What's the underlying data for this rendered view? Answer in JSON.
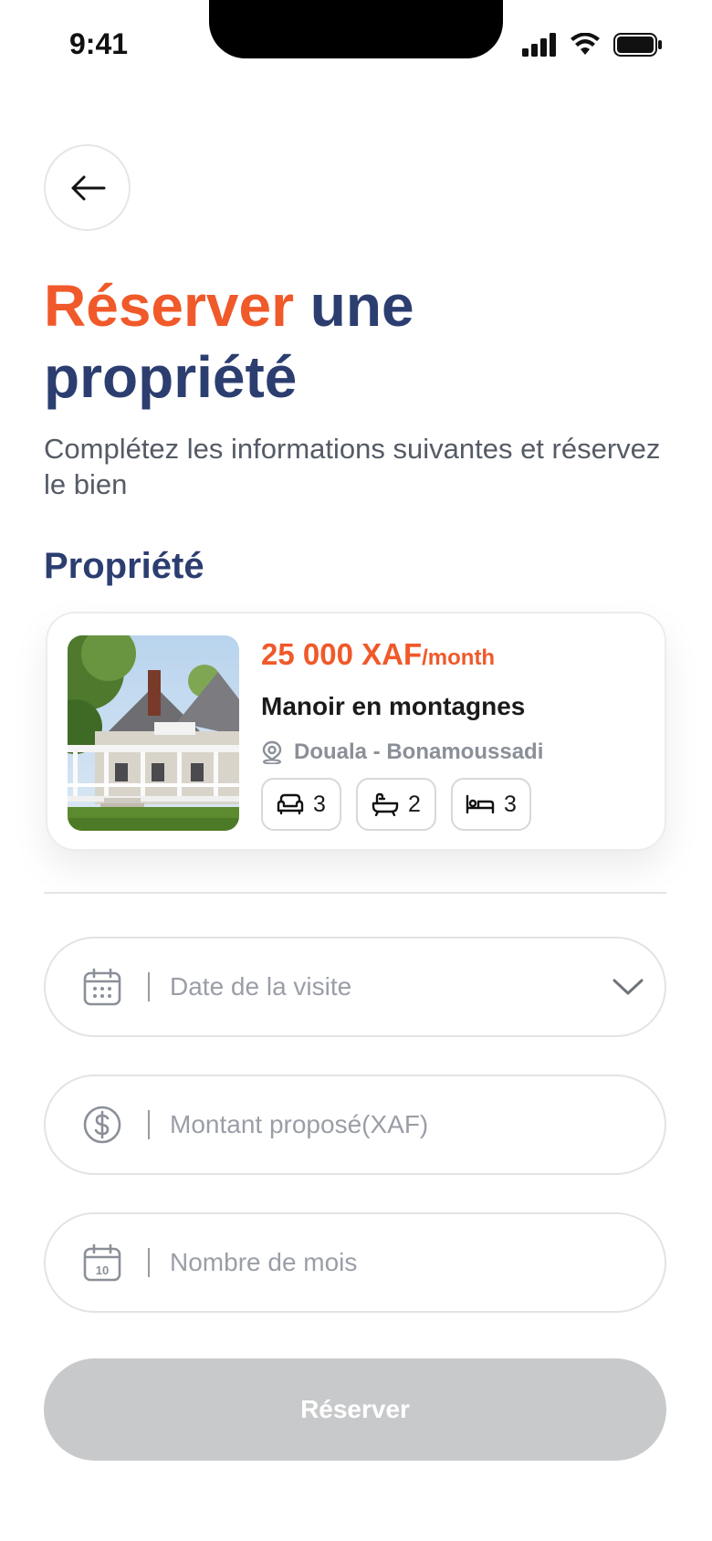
{
  "status_bar": {
    "time": "9:41"
  },
  "header": {
    "title_accent": "Réserver",
    "title_rest": " une propriété",
    "subtitle": "Complétez les informations suivantes et réservez le bien"
  },
  "section": {
    "label": "Propriété"
  },
  "property": {
    "price": "25 000 XAF",
    "price_unit": "/month",
    "name": "Manoir en montagnes",
    "location": "Douala - Bonamoussadi",
    "features": [
      {
        "icon": "sofa-icon",
        "count": "3"
      },
      {
        "icon": "bathtub-icon",
        "count": "2"
      },
      {
        "icon": "bed-icon",
        "count": "3"
      }
    ]
  },
  "form": {
    "visit_date": {
      "placeholder": "Date de la visite",
      "icon": "calendar-icon"
    },
    "amount": {
      "placeholder": "Montant proposé(XAF)",
      "icon": "dollar-icon"
    },
    "months": {
      "placeholder": "Nombre de mois",
      "icon": "calendar-number-icon",
      "icon_text": "10"
    },
    "submit_label": "Réserver"
  },
  "colors": {
    "accent": "#f0592a",
    "primary": "#2c3e70",
    "disabled_button": "#c8c9cb"
  }
}
